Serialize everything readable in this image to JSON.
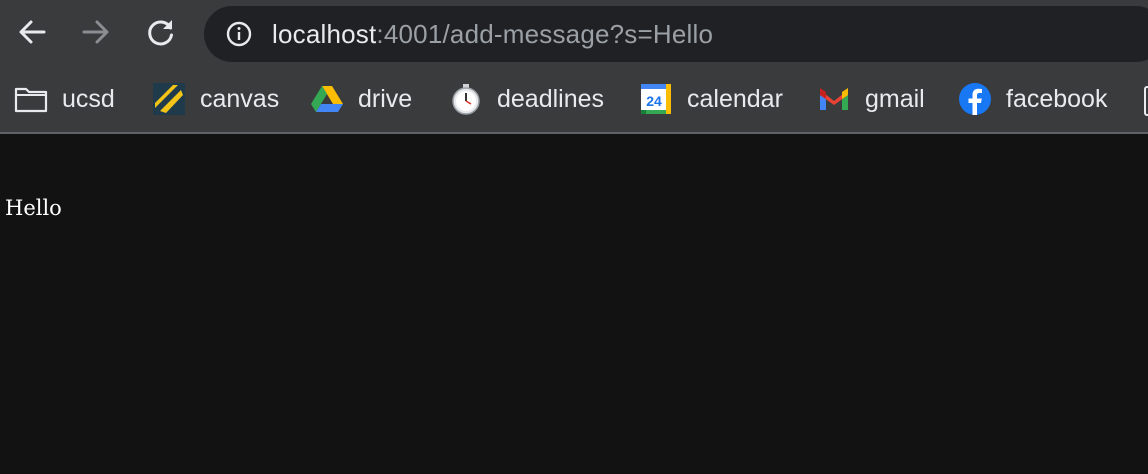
{
  "toolbar": {
    "back_icon": "arrow-left-icon",
    "forward_icon": "arrow-right-icon",
    "reload_icon": "reload-icon",
    "site_info_icon": "info-icon"
  },
  "address_bar": {
    "host": "localhost",
    "path": ":4001/add-message?s=Hello"
  },
  "bookmarks": [
    {
      "label": "ucsd",
      "icon": "folder-icon"
    },
    {
      "label": "canvas",
      "icon": "canvas-icon"
    },
    {
      "label": "drive",
      "icon": "google-drive-icon"
    },
    {
      "label": "deadlines",
      "icon": "stopwatch-icon"
    },
    {
      "label": "calendar",
      "icon": "google-calendar-icon"
    },
    {
      "label": "gmail",
      "icon": "gmail-icon"
    },
    {
      "label": "facebook",
      "icon": "facebook-icon"
    }
  ],
  "calendar_icon_text": "24",
  "page": {
    "message": "Hello"
  },
  "colors": {
    "toolbar_bg": "#3a3b3d",
    "omnibox_bg": "#202124",
    "page_bg": "#121212",
    "text_primary": "#e8eaed",
    "text_secondary": "#9aa0a6"
  }
}
